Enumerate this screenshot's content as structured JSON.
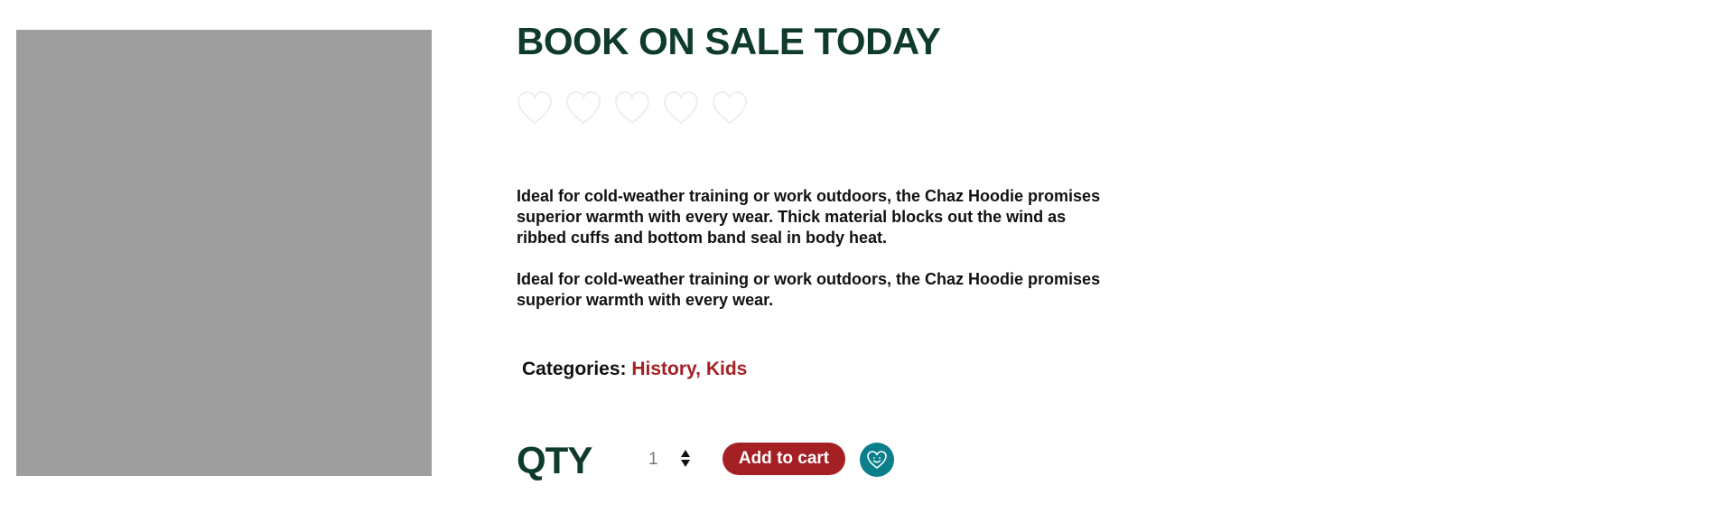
{
  "product": {
    "image_alt": "product image placeholder",
    "title": "BOOK ON SALE TODAY",
    "rating": {
      "value": 0,
      "max": 5,
      "icon": "heart-outline-icon",
      "color": "#eeeeee"
    },
    "description": [
      "Ideal for cold-weather training or work outdoors, the Chaz Hoodie promises superior warmth with every wear. Thick material blocks out the wind as ribbed cuffs and bottom band seal in body heat.",
      "Ideal for cold-weather training or work outdoors, the Chaz Hoodie promises superior warmth with every wear."
    ],
    "categories": {
      "label": "Categories:",
      "values": "History, Kids"
    }
  },
  "purchase": {
    "qty_label": "QTY",
    "qty_value": "1",
    "add_to_cart_label": "Add to cart",
    "wishlist_icon": "heart-smile-icon"
  },
  "colors": {
    "title": "#0f3a2e",
    "accent_red": "#a52025",
    "teal": "#0a7e8a",
    "image_placeholder": "#9e9e9e"
  }
}
